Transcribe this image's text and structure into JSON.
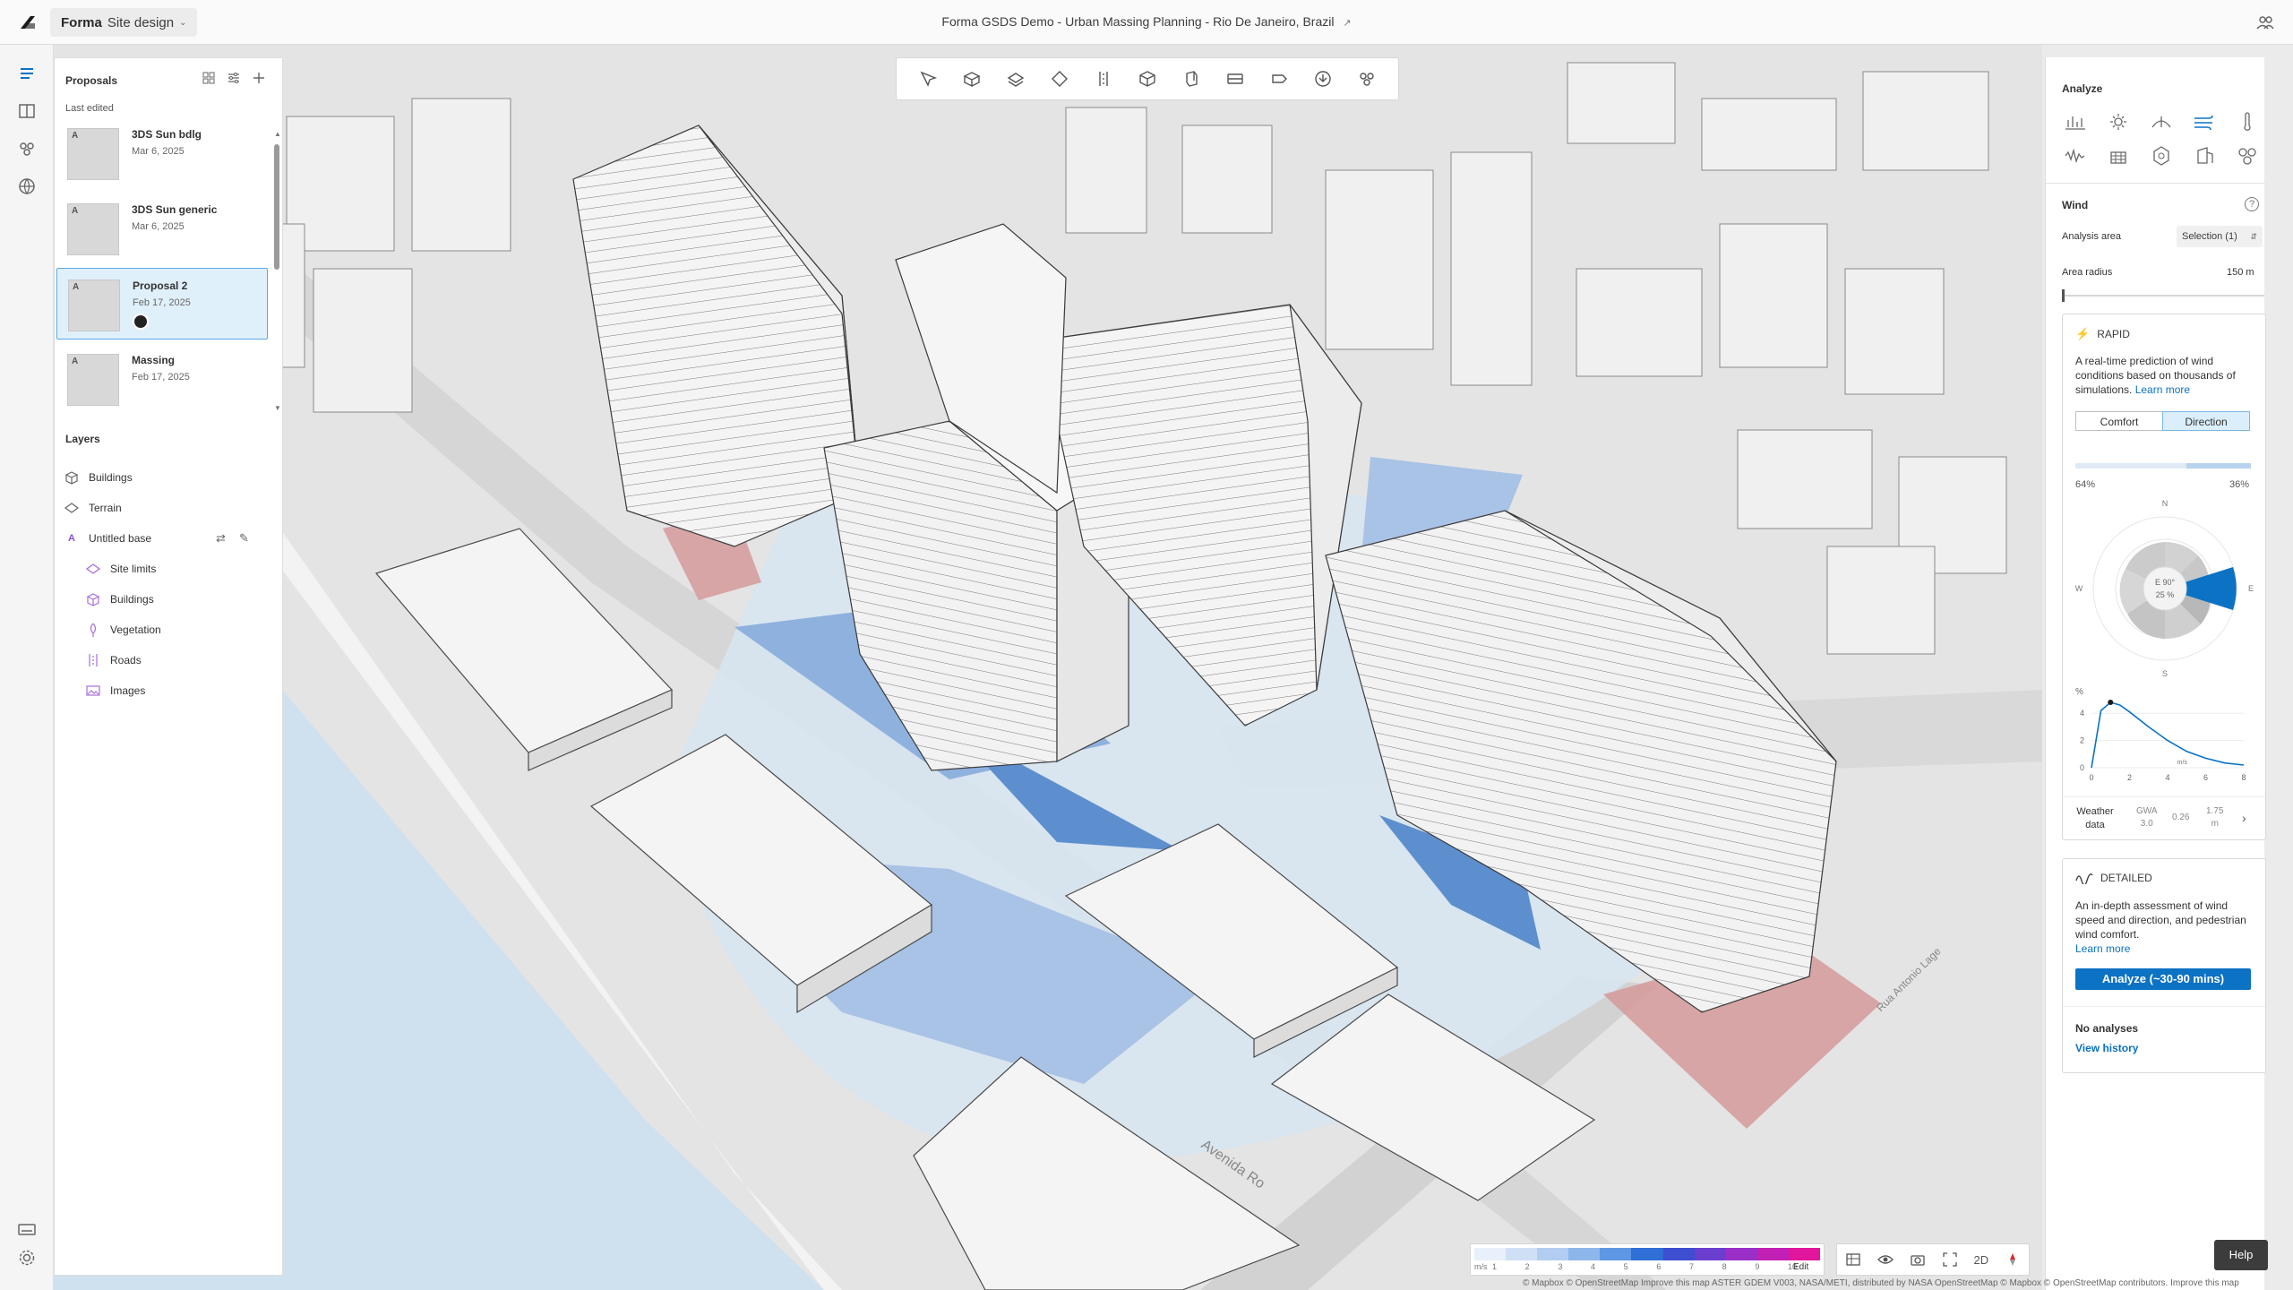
{
  "topbar": {
    "product_brand": "Forma",
    "product_name": "Site design",
    "doc_title": "Forma GSDS Demo - Urban Massing Planning - Rio De Janeiro, Brazil"
  },
  "proposals": {
    "title": "Proposals",
    "subheader": "Last edited",
    "items": [
      {
        "badge": "A",
        "name": "3DS Sun bdlg",
        "date": "Mar 6, 2025",
        "selected": false
      },
      {
        "badge": "A",
        "name": "3DS Sun generic",
        "date": "Mar 6, 2025",
        "selected": false
      },
      {
        "badge": "A",
        "name": "Proposal 2",
        "date": "Feb 17, 2025",
        "selected": true
      },
      {
        "badge": "A",
        "name": "Massing",
        "date": "Feb 17, 2025",
        "selected": false
      }
    ]
  },
  "layers": {
    "title": "Layers",
    "items": [
      {
        "label": "Buildings",
        "icon": "buildings-icon"
      },
      {
        "label": "Terrain",
        "icon": "terrain-icon"
      },
      {
        "label": "Untitled base",
        "icon": "base-icon",
        "badge": "A"
      },
      {
        "label": "Site limits",
        "icon": "site-limits-icon"
      },
      {
        "label": "Buildings",
        "icon": "buildings-icon"
      },
      {
        "label": "Vegetation",
        "icon": "vegetation-icon"
      },
      {
        "label": "Roads",
        "icon": "roads-icon"
      },
      {
        "label": "Images",
        "icon": "images-icon"
      }
    ]
  },
  "analyze": {
    "title": "Analyze",
    "section": "Wind",
    "analysis_area_label": "Analysis area",
    "analysis_area_value": "Selection (1)",
    "area_radius_label": "Area radius",
    "area_radius_value": "150 m",
    "rapid": {
      "title": "RAPID",
      "desc": "A real-time prediction of wind conditions based on thousands of simulations.",
      "learn_more": "Learn more",
      "tab_comfort": "Comfort",
      "tab_direction": "Direction",
      "left_pct": "64%",
      "right_pct": "36%",
      "compass_n": "N",
      "compass_s": "S",
      "compass_e": "E",
      "compass_w": "W",
      "center_dir": "E 90°",
      "center_pct": "25 %",
      "chart_ylabel": "%",
      "chart_xunit": "m/s",
      "weather_label": "Weather data",
      "weather_v1_top": "GWA",
      "weather_v1_bot": "3.0",
      "weather_v2": "0.26",
      "weather_v3_top": "1.75",
      "weather_v3_bot": "m"
    },
    "detailed": {
      "title": "DETAILED",
      "desc": "An in-depth assessment of wind speed and direction, and pedestrian wind comfort.",
      "learn_more": "Learn more",
      "button": "Analyze (~30-90 mins)"
    },
    "no_analyses": "No analyses",
    "view_history": "View history"
  },
  "chart_data": {
    "type": "line",
    "x": [
      0,
      0.5,
      1,
      1.5,
      2,
      3,
      4,
      5,
      6,
      7,
      8
    ],
    "values": [
      0,
      4.2,
      4.8,
      4.6,
      4.1,
      3.0,
      2.0,
      1.2,
      0.7,
      0.35,
      0.2
    ],
    "xticks": [
      "0",
      "2",
      "4",
      "6",
      "8"
    ],
    "yticks": [
      "0",
      "2",
      "4"
    ],
    "xlim": [
      0,
      8
    ],
    "ylim": [
      0,
      5
    ],
    "ylabel": "%",
    "xlabel": "m/s"
  },
  "legend": {
    "unit": "m/s",
    "ticks": [
      "1",
      "2",
      "3",
      "4",
      "5",
      "6",
      "7",
      "8",
      "9",
      "10"
    ],
    "edit": "Edit",
    "colors": [
      "#e8f0fb",
      "#cfdff5",
      "#b3cdf0",
      "#8db6eb",
      "#5e97e3",
      "#2f6fd6",
      "#3d4ed0",
      "#6b3ed0",
      "#9a2fc8",
      "#c21fb4",
      "#e0169c"
    ]
  },
  "viewtools": {
    "mode_2d": "2D"
  },
  "help": "Help",
  "attribution": "© Mapbox © OpenStreetMap Improve this map ASTER GDEM V003, NASA/METI, distributed by NASA OpenStreetMap © Mapbox © OpenStreetMap contributors. Improve this map"
}
